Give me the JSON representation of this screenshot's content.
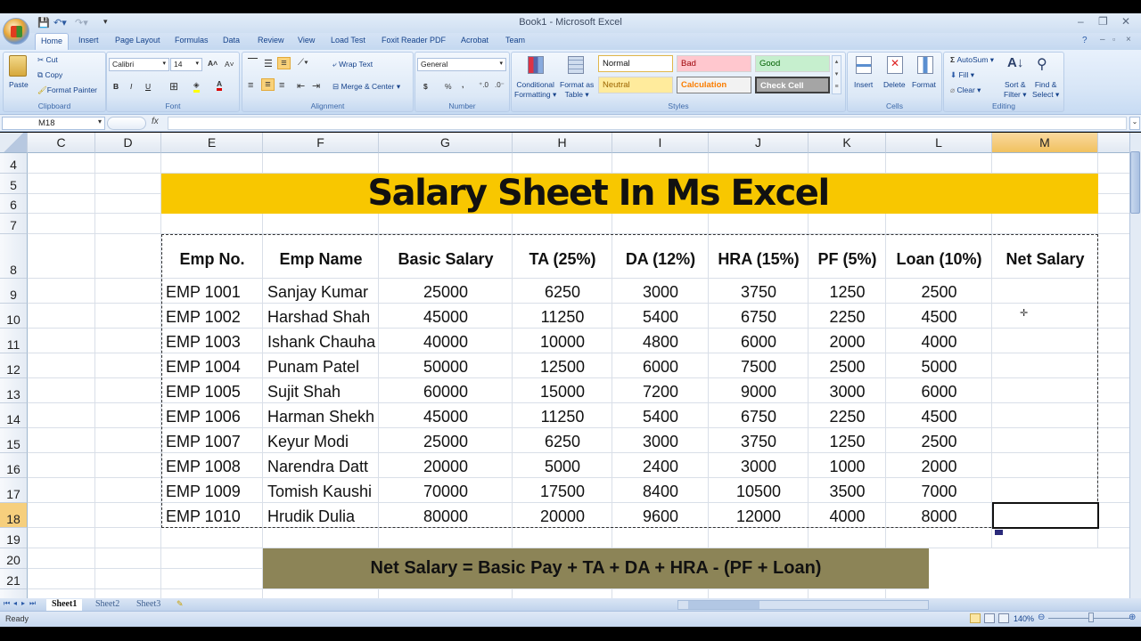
{
  "window": {
    "title": "Book1 - Microsoft Excel",
    "controls": {
      "minimize": "–",
      "restore": "❐",
      "close": "✕"
    }
  },
  "ribbon_tabs": [
    "Home",
    "Insert",
    "Page Layout",
    "Formulas",
    "Data",
    "Review",
    "View",
    "Load Test",
    "Foxit Reader PDF",
    "Acrobat",
    "Team"
  ],
  "clipboard": {
    "paste": "Paste",
    "cut": "Cut",
    "copy": "Copy",
    "format_painter": "Format Painter",
    "label": "Clipboard"
  },
  "font": {
    "name": "Calibri",
    "size": "14",
    "label": "Font",
    "bold": "B",
    "italic": "I",
    "underline": "U"
  },
  "alignment": {
    "wrap_text": "Wrap Text",
    "merge_center": "Merge & Center",
    "label": "Alignment"
  },
  "number": {
    "format": "General",
    "currency": "$",
    "percent": "%",
    "comma": ",",
    "label": "Number"
  },
  "styles": {
    "conditional_formatting": [
      "Conditional",
      "Formatting"
    ],
    "format_as_table": [
      "Format as",
      "Table"
    ],
    "gallery": [
      {
        "name": "Normal",
        "bg": "#ffffff",
        "fg": "#111111"
      },
      {
        "name": "Bad",
        "bg": "#ffc7ce",
        "fg": "#9c0006"
      },
      {
        "name": "Good",
        "bg": "#c6efce",
        "fg": "#006100"
      },
      {
        "name": "Neutral",
        "bg": "#ffeb9c",
        "fg": "#9c6500"
      },
      {
        "name": "Calculation",
        "bg": "#f2f2f2",
        "fg": "#fa7d00"
      },
      {
        "name": "Check Cell",
        "bg": "#a5a5a5",
        "fg": "#ffffff"
      }
    ],
    "label": "Styles"
  },
  "cells": {
    "insert": "Insert",
    "delete": "Delete",
    "format": "Format",
    "label": "Cells"
  },
  "editing": {
    "autosum": "AutoSum",
    "fill": "Fill",
    "clear": "Clear",
    "sort_filter": [
      "Sort &",
      "Filter"
    ],
    "find_select": [
      "Find &",
      "Select"
    ],
    "label": "Editing"
  },
  "formula_bar": {
    "name_box": "M18",
    "fx": "fx",
    "value": ""
  },
  "columns": [
    "C",
    "D",
    "E",
    "F",
    "G",
    "H",
    "I",
    "J",
    "K",
    "L",
    "M"
  ],
  "selected_column": "M",
  "rows": [
    "4",
    "5",
    "6",
    "7",
    "8",
    "9",
    "10",
    "11",
    "12",
    "13",
    "14",
    "15",
    "16",
    "17",
    "18",
    "19",
    "20",
    "21"
  ],
  "selected_row": "18",
  "sheet": {
    "title": "Salary Sheet In Ms Excel",
    "headers": [
      "Emp No.",
      "Emp Name",
      "Basic Salary",
      "TA (25%)",
      "DA (12%)",
      "HRA (15%)",
      "PF (5%)",
      "Loan (10%)",
      "Net Salary"
    ],
    "records": [
      [
        "EMP 1001",
        "Sanjay Kumar",
        "25000",
        "6250",
        "3000",
        "3750",
        "1250",
        "2500",
        ""
      ],
      [
        "EMP 1002",
        "Harshad Shah",
        "45000",
        "11250",
        "5400",
        "6750",
        "2250",
        "4500",
        ""
      ],
      [
        "EMP 1003",
        "Ishank Chauha",
        "40000",
        "10000",
        "4800",
        "6000",
        "2000",
        "4000",
        ""
      ],
      [
        "EMP 1004",
        "Punam Patel",
        "50000",
        "12500",
        "6000",
        "7500",
        "2500",
        "5000",
        ""
      ],
      [
        "EMP 1005",
        "Sujit Shah",
        "60000",
        "15000",
        "7200",
        "9000",
        "3000",
        "6000",
        ""
      ],
      [
        "EMP 1006",
        "Harman Shekh",
        "45000",
        "11250",
        "5400",
        "6750",
        "2250",
        "4500",
        ""
      ],
      [
        "EMP 1007",
        "Keyur Modi",
        "25000",
        "6250",
        "3000",
        "3750",
        "1250",
        "2500",
        ""
      ],
      [
        "EMP 1008",
        "Narendra Datt",
        "20000",
        "5000",
        "2400",
        "3000",
        "1000",
        "2000",
        ""
      ],
      [
        "EMP 1009",
        "Tomish Kaushi",
        "70000",
        "17500",
        "8400",
        "10500",
        "3500",
        "7000",
        ""
      ],
      [
        "EMP 1010",
        "Hrudik Dulia",
        "80000",
        "20000",
        "9600",
        "12000",
        "4000",
        "8000",
        ""
      ]
    ],
    "formula_note": "Net Salary = Basic Pay + TA + DA + HRA - (PF + Loan)",
    "banner_color": "#f8c700",
    "formula_color": "#8c8457"
  },
  "sheet_tabs": [
    "Sheet1",
    "Sheet2",
    "Sheet3"
  ],
  "active_sheet": "Sheet1",
  "status": {
    "text": "Ready",
    "zoom": "140%"
  }
}
